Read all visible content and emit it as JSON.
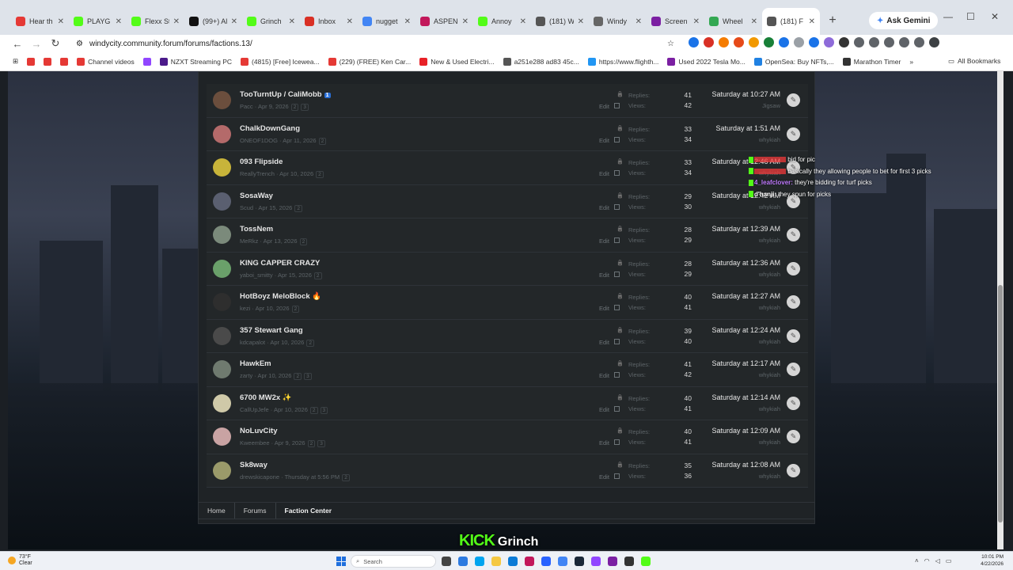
{
  "tabs": [
    {
      "label": "Hear th",
      "color": "#e53935"
    },
    {
      "label": "PLAYG",
      "color": "#53fc18"
    },
    {
      "label": "Flexx St",
      "color": "#53fc18"
    },
    {
      "label": "(99+) Al",
      "color": "#111111"
    },
    {
      "label": "Grinch",
      "color": "#53fc18"
    },
    {
      "label": "Inbox",
      "color": "#d93025"
    },
    {
      "label": "nugget",
      "color": "#4285f4"
    },
    {
      "label": "ASPEN",
      "color": "#c2185b"
    },
    {
      "label": "Annoy",
      "color": "#53fc18"
    },
    {
      "label": "(181) W",
      "color": "#555555"
    },
    {
      "label": "Windy",
      "color": "#666666"
    },
    {
      "label": "Screen",
      "color": "#7b1fa2"
    },
    {
      "label": "Wheel",
      "color": "#34a853"
    },
    {
      "label": "(181) F",
      "color": "#555555"
    }
  ],
  "gemini_label": "Ask Gemini",
  "url": "windycity.community.forum/forums/factions.13/",
  "bookmarks": [
    {
      "label": "",
      "color": "#e53935"
    },
    {
      "label": "",
      "color": "#e53935"
    },
    {
      "label": "",
      "color": "#e53935"
    },
    {
      "label": "Channel videos",
      "color": "#e53935"
    },
    {
      "label": "",
      "color": "#9146ff"
    },
    {
      "label": "NZXT Streaming PC",
      "color": "#4b1a8a"
    },
    {
      "label": "(4815) [Free] Icewea...",
      "color": "#e53935"
    },
    {
      "label": "(229) (FREE) Ken Car...",
      "color": "#e53935"
    },
    {
      "label": "New & Used Electri...",
      "color": "#e82127"
    },
    {
      "label": "a251e288 ad83 45c...",
      "color": "#555555"
    },
    {
      "label": "https://www.flighth...",
      "color": "#2196f3"
    },
    {
      "label": "Used 2022 Tesla Mo...",
      "color": "#7b1fa2"
    },
    {
      "label": "OpenSea: Buy NFTs,...",
      "color": "#2081e2"
    },
    {
      "label": "Marathon Timer",
      "color": "#333333"
    }
  ],
  "all_bookmarks": "All Bookmarks",
  "labels": {
    "replies": "Replies:",
    "views": "Views:",
    "edit": "Edit"
  },
  "threads": [
    {
      "title": "TooTurntUp / CaliMobb",
      "badge": "1",
      "author": "Pacc",
      "date": "Apr 9, 2026",
      "pages": "2 3",
      "replies": "41",
      "views": "42",
      "last": "Saturday at 10:27 AM",
      "last_user": "Jigsaw",
      "av": "#6b4e3d"
    },
    {
      "title": "ChalkDownGang",
      "author": "ONEOF1DOG",
      "date": "Apr 11, 2026",
      "pages": "2",
      "replies": "33",
      "views": "34",
      "last": "Saturday at 1:51 AM",
      "last_user": "whykiah",
      "av": "#b46a6a"
    },
    {
      "title": "093 Flipside",
      "author": "ReallyTrench",
      "date": "Apr 10, 2026",
      "pages": "2",
      "replies": "33",
      "views": "34",
      "last": "Saturday at 12:46 AM",
      "last_user": "whykiah",
      "av": "#c8b43a"
    },
    {
      "title": "SosaWay",
      "author": "Scud",
      "date": "Apr 15, 2026",
      "pages": "2",
      "replies": "29",
      "views": "30",
      "last": "Saturday at 12:42 AM",
      "last_user": "whykiah",
      "av": "#5a5f70"
    },
    {
      "title": "TossNem",
      "author": "MeRkz",
      "date": "Apr 13, 2026",
      "pages": "2",
      "replies": "28",
      "views": "29",
      "last": "Saturday at 12:39 AM",
      "last_user": "whykiah",
      "av": "#7b8a7b"
    },
    {
      "title": "KING CAPPER CRAZY",
      "author": "yaboi_smitty",
      "date": "Apr 15, 2026",
      "pages": "2",
      "replies": "28",
      "views": "29",
      "last": "Saturday at 12:36 AM",
      "last_user": "whykiah",
      "av": "#6aa06a"
    },
    {
      "title": "HotBoyz MeloBlock 🔥",
      "author": "kezi",
      "date": "Apr 10, 2026",
      "pages": "2",
      "replies": "40",
      "views": "41",
      "last": "Saturday at 12:27 AM",
      "last_user": "whykiah",
      "av": "#2e2e2e"
    },
    {
      "title": "357 Stewart Gang",
      "author": "kdcapalot",
      "date": "Apr 10, 2026",
      "pages": "2",
      "replies": "39",
      "views": "40",
      "last": "Saturday at 12:24 AM",
      "last_user": "whykiah",
      "av": "#4a4a4a"
    },
    {
      "title": "HawkEm",
      "author": "zarty",
      "date": "Apr 10, 2026",
      "pages": "2 3",
      "replies": "41",
      "views": "42",
      "last": "Saturday at 12:17 AM",
      "last_user": "whykiah",
      "av": "#6f7a6f"
    },
    {
      "title": "6700 MW2x ✨",
      "author": "CallUpJefe",
      "date": "Apr 10, 2026",
      "pages": "2 3",
      "replies": "40",
      "views": "41",
      "last": "Saturday at 12:14 AM",
      "last_user": "whykiah",
      "av": "#cfc9a8"
    },
    {
      "title": "NoLuvCity",
      "author": "Kweembee",
      "date": "Apr 9, 2026",
      "pages": "2 3",
      "replies": "40",
      "views": "41",
      "last": "Saturday at 12:09 AM",
      "last_user": "whykiah",
      "av": "#c9a3a3"
    },
    {
      "title": "Sk8way",
      "author": "drewskicapone",
      "date": "Thursday at 5:56 PM",
      "pages": "2",
      "replies": "35",
      "views": "36",
      "last": "Saturday at 12:08 AM",
      "last_user": "whykiah",
      "av": "#9a9a6a"
    }
  ],
  "breadcrumbs": [
    "Home",
    "Forums",
    "Faction Center"
  ],
  "chat": [
    {
      "user": "",
      "text": "bid for pic",
      "color": "#ff3b3b"
    },
    {
      "user": "",
      "text": "basically they allowing people to bet for first 3 picks",
      "color": "#ff3b3b"
    },
    {
      "user": "4_leafclover:",
      "text": "they're bidding for turf picks",
      "color": "#c07bff"
    },
    {
      "user": "d'hanji:",
      "text": "they spun for picks",
      "color": "#ffffff"
    }
  ],
  "overlay": {
    "brand": "KICK",
    "name": "Grinch"
  },
  "taskbar": {
    "temp": "73°F",
    "weather": "Clear",
    "search": "Search",
    "time": "10:01 PM",
    "date": "4/22/2026"
  }
}
